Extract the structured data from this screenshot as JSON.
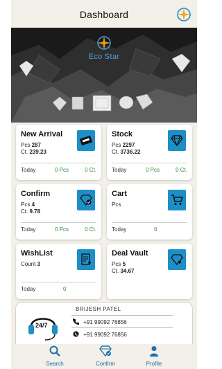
{
  "header": {
    "title": "Dashboard",
    "compass_icon": "compass-icon"
  },
  "banner": {
    "brand": "Eco Star"
  },
  "cards": [
    {
      "title": "New Arrival",
      "line1_label": "Pcs",
      "line1_value": "287",
      "line2_label": "Ct.",
      "line2_value": "239.23",
      "today": "Today",
      "today_pcs": "0 Pcs",
      "today_ct": "0 Ct.",
      "icon": "new-arrival-icon"
    },
    {
      "title": "Stock",
      "line1_label": "Pcs",
      "line1_value": "2297",
      "line2_label": "Ct.",
      "line2_value": "3736.22",
      "today": "Today",
      "today_pcs": "0 Pcs",
      "today_ct": "0 Ct.",
      "icon": "diamond-icon"
    },
    {
      "title": "Confirm",
      "line1_label": "Pcs",
      "line1_value": "4",
      "line2_label": "Ct.",
      "line2_value": "9.78",
      "today": "Today",
      "today_pcs": "0 Pcs",
      "today_ct": "0 Ct.",
      "icon": "confirm-diamond-icon"
    },
    {
      "title": "Cart",
      "line1_label": "Pcs",
      "today": "Today",
      "today_val": "0",
      "icon": "cart-icon"
    },
    {
      "title": "WishList",
      "line1_label": "Count",
      "line1_value": "3",
      "today": "Today",
      "today_val": "0",
      "icon": "wishlist-icon"
    },
    {
      "title": "Deal Vault",
      "line1_label": "Pcs",
      "line1_value": "5",
      "line2_label": "Ct.",
      "line2_value": "34.67",
      "icon": "deal-vault-icon"
    }
  ],
  "contact": {
    "name": "BRIJESH PATEL",
    "support_label": "24/7",
    "phone": "+91 99092 76856",
    "whatsapp": "+91 99092 76856"
  },
  "nav": [
    {
      "label": "Search",
      "icon": "search-icon"
    },
    {
      "label": "Confirm",
      "icon": "confirm-icon"
    },
    {
      "label": "Profile",
      "icon": "profile-icon"
    }
  ],
  "colors": {
    "accent": "#1d8fc7",
    "positive": "#2a8a3a",
    "background": "#f3efe9"
  }
}
